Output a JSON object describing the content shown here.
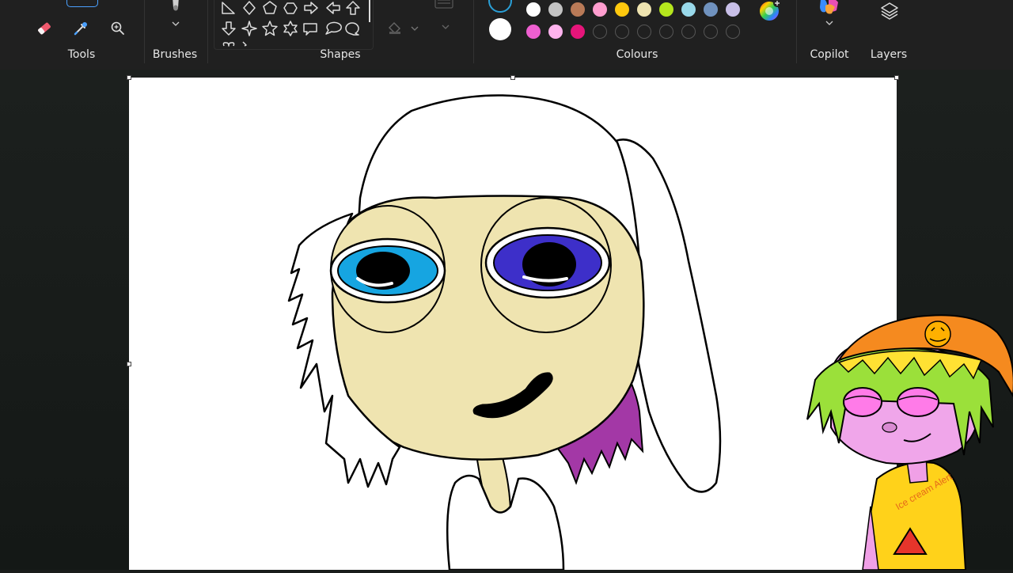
{
  "ribbon": {
    "groups": {
      "tools": "Tools",
      "brushes": "Brushes",
      "shapes": "Shapes",
      "colours": "Colours",
      "copilot": "Copilot",
      "layers": "Layers"
    }
  },
  "palette": {
    "row1": [
      "#ffffff",
      "#c3c3c3",
      "#b97a57",
      "#ff9ecf",
      "#ffc90e",
      "#efe4b0",
      "#b5e61d",
      "#99d9ea",
      "#7092be",
      "#c8bfe7"
    ],
    "row2": [
      "#ee5fd0",
      "#ffb3ee",
      "#e6157a"
    ],
    "primary": "#ffffff"
  },
  "overlay": {
    "shirt_text": "Ice cream Alert"
  }
}
